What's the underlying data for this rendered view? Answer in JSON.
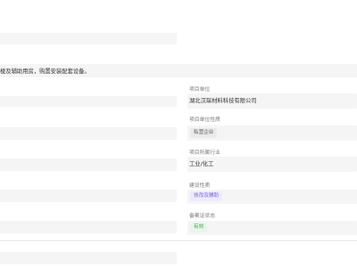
{
  "description_snippet": "楼及辅助用房，购置安装配套设备。",
  "right_panel": {
    "unit": {
      "label": "项目单位",
      "value": "湖北汉琛材料科技有限公司"
    },
    "unit_nature": {
      "label": "项目单位性质",
      "value": "私营企业"
    },
    "industry": {
      "label": "项目所属行业",
      "value": "工业/化工"
    },
    "construction_nature": {
      "label": "建设性质",
      "value": "技改及辅助"
    },
    "filing_status": {
      "label": "备案证状态",
      "value": "有效"
    }
  },
  "colors": {
    "tag_gray_bg": "#eaeaea",
    "tag_purple_bg": "#eeeaff",
    "tag_purple_text": "#7565d6",
    "tag_green_bg": "#e7f6e9",
    "tag_green_text": "#3fa94d"
  }
}
